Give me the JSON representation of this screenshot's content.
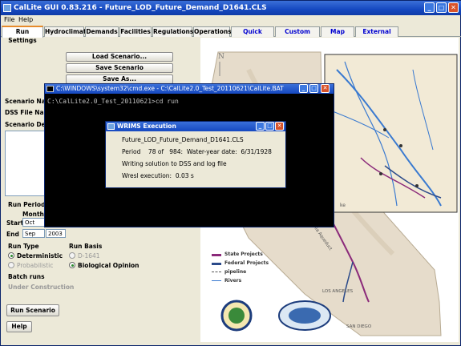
{
  "app": {
    "title": "CalLite GUI 0.83.216 - Future_LOD_Future_Demand_D1641.CLS"
  },
  "menu": [
    "File",
    "Help"
  ],
  "tabs": [
    {
      "label": "Run Settings",
      "active": true,
      "blue": false
    },
    {
      "label": "Hydroclimate",
      "active": false,
      "blue": false
    },
    {
      "label": "Demands",
      "active": false,
      "blue": false
    },
    {
      "label": "Facilities",
      "active": false,
      "blue": false
    },
    {
      "label": "Regulations",
      "active": false,
      "blue": false
    },
    {
      "label": "Operations",
      "active": false,
      "blue": false
    },
    {
      "label": "Quick Results",
      "active": false,
      "blue": true
    },
    {
      "label": "Custom Results",
      "active": false,
      "blue": true
    },
    {
      "label": "Map View",
      "active": false,
      "blue": true
    },
    {
      "label": "External PDF",
      "active": false,
      "blue": true
    }
  ],
  "scenario_buttons": {
    "load": "Load Scenario...",
    "save": "Save Scenario",
    "save_as": "Save As..."
  },
  "fields": {
    "scenario_name": "Scenario Name",
    "dss_file_name": "DSS File Name",
    "scenario_desc": "Scenario Descr"
  },
  "run_period": {
    "label": "Run Period",
    "month_label": "Month",
    "start_label": "Start",
    "start_month": "Oct",
    "end_label": "End",
    "end_month": "Sep",
    "end_year": "2003"
  },
  "run_type": {
    "label": "Run Type",
    "options": [
      "Deterministic",
      "Probabilistic"
    ],
    "selected": "Deterministic"
  },
  "run_basis": {
    "label": "Run Basis",
    "options": [
      "D-1641",
      "Biological Opinion"
    ],
    "selected": "Biological Opinion"
  },
  "batch": {
    "label": "Batch runs",
    "status": "Under Construction"
  },
  "bottom_buttons": {
    "run": "Run Scenario",
    "help": "Help"
  },
  "cmd": {
    "title": "C:\\WINDOWS\\system32\\cmd.exe - C:\\CalLite2.0_Test_20110621\\CalLite.BAT",
    "text": "C:\\CalLite2.0_Test_20110621>cd run"
  },
  "wrims": {
    "title": "WRIMS Execution",
    "lines": [
      "Future_LOD_Future_Demand_D1641.CLS",
      "Period    78 of   984:  Water-year date:  6/31/1928",
      "Writing solution to DSS and log file",
      "Wresl execution:  0.03 s"
    ]
  },
  "map": {
    "north_label": "N",
    "legend": [
      {
        "label": "State Projects",
        "color": "#8b2a7a"
      },
      {
        "label": "Federal Projects",
        "color": "#2b4a8a"
      },
      {
        "label": "pipeline",
        "color": "#555555"
      },
      {
        "label": "Rivers",
        "color": "#3a7ad0"
      }
    ],
    "labels": {
      "los_angeles": "LOS ANGELES",
      "san_diego": "SAN DIEGO",
      "aqueduct": "California Aqueduct",
      "lake": "ke"
    }
  }
}
